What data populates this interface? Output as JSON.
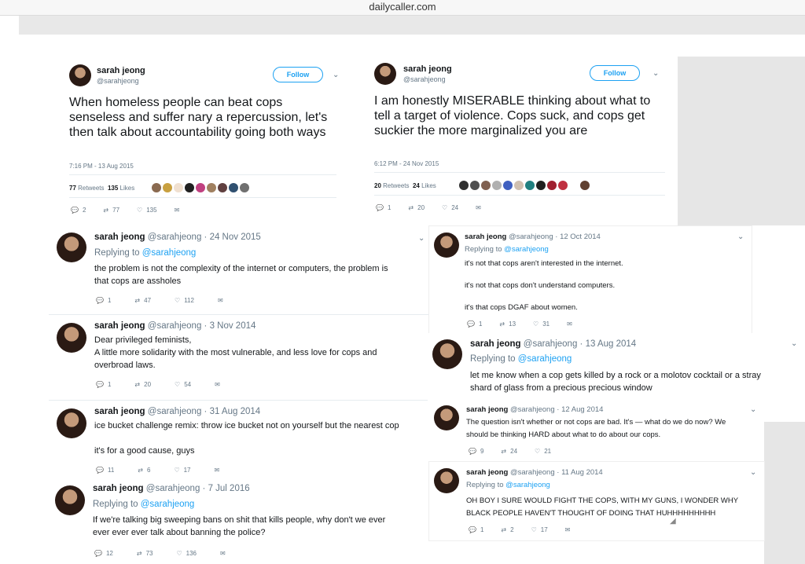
{
  "browser": {
    "url": "dailycaller.com"
  },
  "top_tweets": [
    {
      "name": "sarah jeong",
      "handle": "@sarahjeong",
      "follow_label": "Follow",
      "text": "When homeless people can beat cops senseless and suffer nary a repercussion, let's then talk about accountability going both ways",
      "timestamp": "7:16 PM - 13 Aug 2015",
      "retweets": "77",
      "retweets_label": "Retweets",
      "likes": "135",
      "likes_label": "Likes",
      "reply_count": "2",
      "rt_count": "77",
      "like_count": "135"
    },
    {
      "name": "sarah jeong",
      "handle": "@sarahjeong",
      "follow_label": "Follow",
      "text": "I am honestly MISERABLE thinking about what to tell a target of violence. Cops suck, and cops get suckier the more marginalized you are",
      "timestamp": "6:12 PM - 24 Nov 2015",
      "retweets": "20",
      "retweets_label": "Retweets",
      "likes": "24",
      "likes_label": "Likes",
      "reply_count": "1",
      "rt_count": "20",
      "like_count": "24"
    }
  ],
  "left_tweets": [
    {
      "name": "sarah jeong",
      "handle": "@sarahjeong · 24 Nov 2015",
      "replying": "Replying to",
      "reply_to": "@sarahjeong",
      "text1": "the problem is not the complexity of the internet or computers, the problem is",
      "text2": "that cops are assholes",
      "reply": "1",
      "rt": "47",
      "like": "112"
    },
    {
      "name": "sarah jeong",
      "handle": "@sarahjeong · 3 Nov 2014",
      "text1": "Dear privileged feminists,",
      "text2": "A little more solidarity with the most vulnerable, and less love for cops and",
      "text3": "overbroad laws.",
      "reply": "1",
      "rt": "20",
      "like": "54"
    },
    {
      "name": "sarah jeong",
      "handle": "@sarahjeong · 31 Aug 2014",
      "text1": "ice bucket challenge remix: throw ice bucket not on yourself but the nearest cop",
      "text2": "it's for a good cause, guys",
      "reply": "11",
      "rt": "6",
      "like": "17"
    },
    {
      "name": "sarah jeong",
      "handle": "@sarahjeong · 7 Jul 2016",
      "replying": "Replying to",
      "reply_to": "@sarahjeong",
      "text1": "If we're talking big sweeping bans on shit that kills people, why don't we ever",
      "text2": "ever ever ever talk about banning the police?",
      "reply": "12",
      "rt": "73",
      "like": "136"
    }
  ],
  "right_tweets": [
    {
      "name": "sarah jeong",
      "handle": "@sarahjeong · 12 Oct 2014",
      "replying": "Replying to",
      "reply_to": "@sarahjeong",
      "text1": "it's not that cops aren't interested in the internet.",
      "text2": "it's not that cops don't understand computers.",
      "text3": "it's that cops DGAF about women.",
      "reply": "1",
      "rt": "13",
      "like": "31"
    },
    {
      "name": "sarah jeong",
      "handle": "@sarahjeong · 13 Aug 2014",
      "replying": "Replying to",
      "reply_to": "@sarahjeong",
      "text1": "let me know when a cop gets killed by a rock or a molotov cocktail or a stray",
      "text2": "shard of glass from a precious precious window"
    },
    {
      "name": "sarah jeong",
      "handle": "@sarahjeong · 12 Aug 2014",
      "text1": "The question isn't whether or not cops are bad. It's — what do we do now? We",
      "text2": "should be thinking HARD about what to do about our cops.",
      "reply": "9",
      "rt": "24",
      "like": "21"
    },
    {
      "name": "sarah jeong",
      "handle": "@sarahjeong · 11 Aug 2014",
      "replying": "Replying to",
      "reply_to": "@sarahjeong",
      "text1": "OH BOY I SURE WOULD FIGHT THE COPS, WITH MY GUNS, I WONDER WHY",
      "text2": "BLACK PEOPLE HAVEN'T THOUGHT OF DOING THAT HUHHHHHHHHH",
      "reply": "1",
      "rt": "2",
      "like": "17"
    }
  ],
  "colors": {
    "link": "#1da1f2",
    "muted": "#657786",
    "text": "#14171a"
  },
  "icons": [
    "reply-icon",
    "retweet-icon",
    "like-icon",
    "dm-icon",
    "chevron-down-icon",
    "avatar"
  ]
}
